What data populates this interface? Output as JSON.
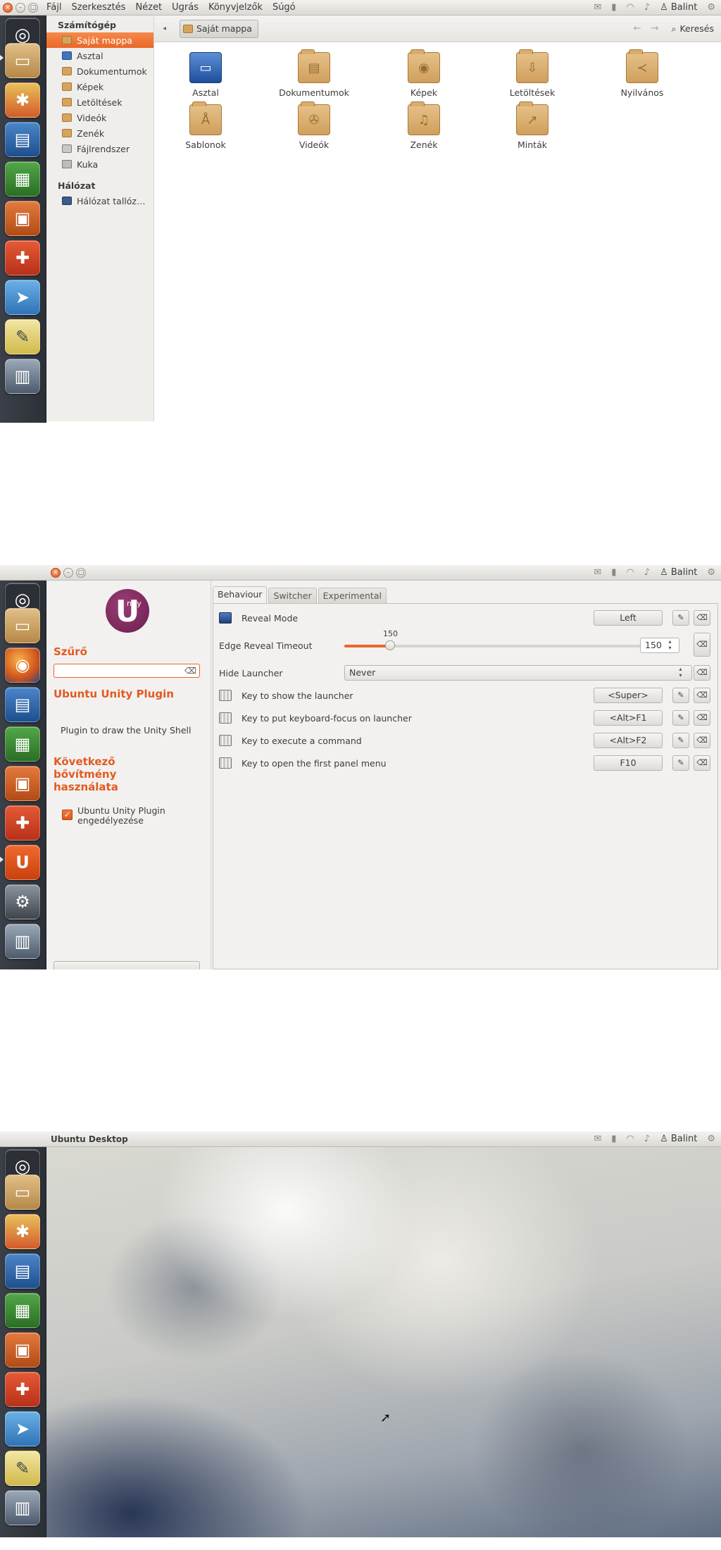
{
  "shot1": {
    "menus": [
      "Fájl",
      "Szerkesztés",
      "Nézet",
      "Ugrás",
      "Könyvjelzők",
      "Súgó"
    ],
    "user": "Balint",
    "sidebar": {
      "computer_heading": "Számítógép",
      "computer_items": [
        "Saját mappa",
        "Asztal",
        "Dokumentumok",
        "Képek",
        "Letöltések",
        "Videók",
        "Zenék",
        "Fájlrendszer",
        "Kuka"
      ],
      "network_heading": "Hálózat",
      "network_items": [
        "Hálózat tallóz…"
      ]
    },
    "breadcrumb": "Saját mappa",
    "search_label": "Keresés",
    "files": [
      "Asztal",
      "Dokumentumok",
      "Képek",
      "Letöltések",
      "Nyilvános",
      "Sablonok",
      "Videók",
      "Zenék",
      "Minták"
    ]
  },
  "shot2": {
    "user": "Balint",
    "filter_heading": "Szűrő",
    "plugin_title": "Ubuntu Unity Plugin",
    "plugin_desc": "Plugin to draw the Unity Shell",
    "use_heading_lines": [
      "Következő",
      "bővítmény",
      "használata"
    ],
    "enable_label": "Ubuntu Unity Plugin engedélyezése",
    "tabs": [
      "Behaviour",
      "Switcher",
      "Experimental"
    ],
    "settings": {
      "reveal_mode_label": "Reveal Mode",
      "reveal_mode_value": "Left",
      "edge_timeout_label": "Edge Reveal Timeout",
      "edge_timeout_value": "150",
      "edge_timeout_fraction": 0.15,
      "hide_launcher_label": "Hide Launcher",
      "hide_launcher_value": "Never",
      "keys": [
        {
          "label": "Key to show the launcher",
          "value": "<Super>"
        },
        {
          "label": "Key to put keyboard-focus on launcher",
          "value": "<Alt>F1"
        },
        {
          "label": "Key to execute a command",
          "value": "<Alt>F2"
        },
        {
          "label": "Key to open the first panel menu",
          "value": "F10"
        }
      ]
    }
  },
  "shot3": {
    "title": "Ubuntu Desktop",
    "user": "Balint"
  }
}
